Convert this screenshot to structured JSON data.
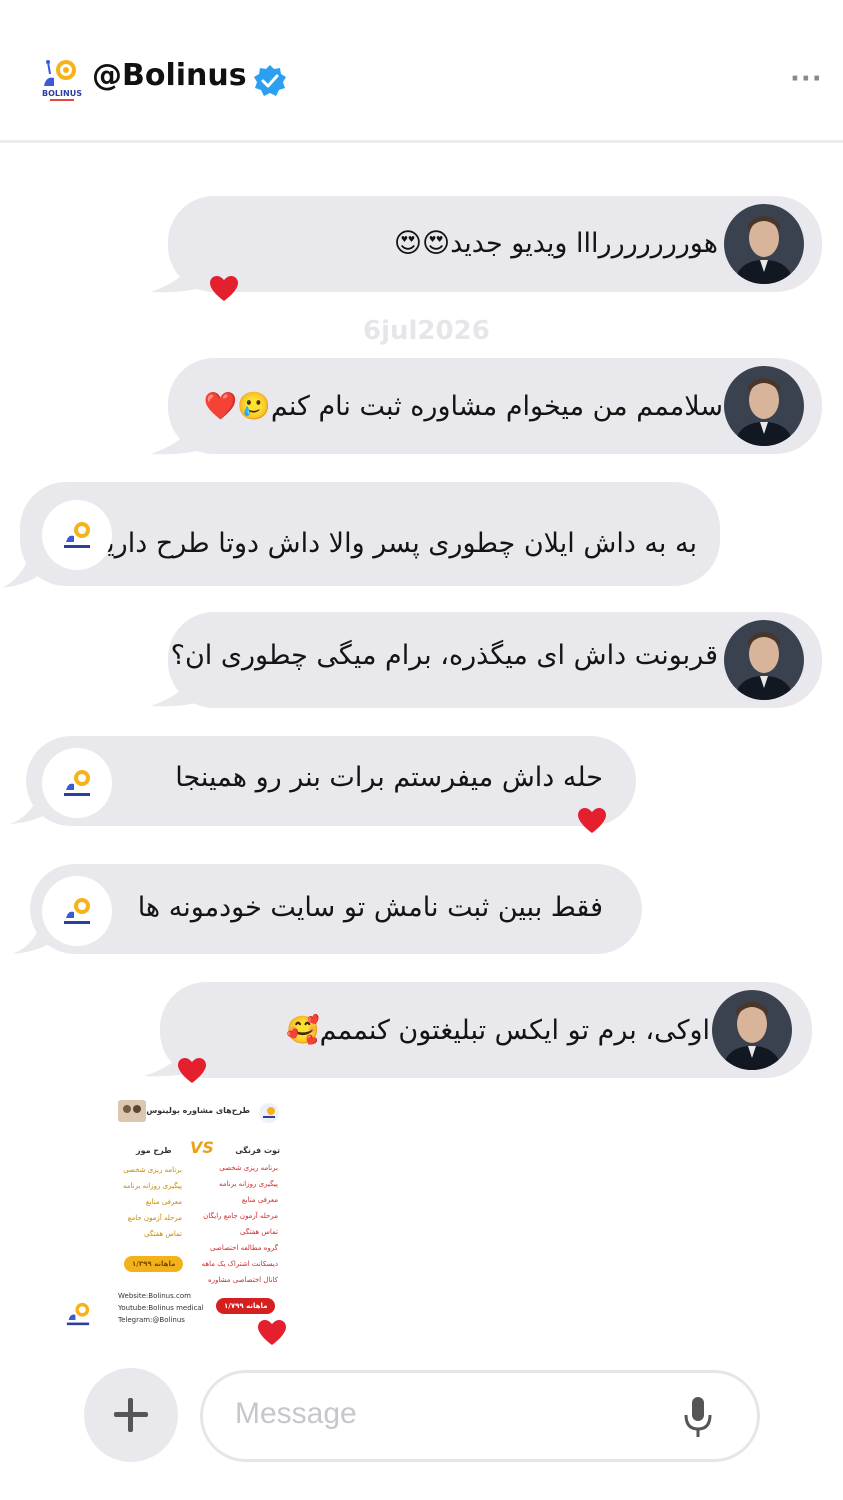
{
  "header": {
    "handle": "@Bolinus",
    "logo_text": "BOLINUS",
    "verified_color": "#2ca0f0",
    "more_label": "···"
  },
  "watermark": "6jul2026",
  "messages": [
    {
      "side": "right",
      "text": "هورررررررااا ویدیو جدید😍😍",
      "hearted": true
    },
    {
      "side": "right",
      "text": "سلاممم من میخوام مشاوره ثبت نام کنم🥲❤️",
      "hearted": false
    },
    {
      "side": "left",
      "text": "به به داش ایلان چطوری پسر والا داش دوتا طرح داریم",
      "hearted": false
    },
    {
      "side": "right",
      "text": "قربونت داش ای میگذره، برام میگی چطوری ان؟",
      "hearted": false
    },
    {
      "side": "left",
      "text": "حله داش میفرستم برات بنر رو همینجا",
      "hearted": true
    },
    {
      "side": "left",
      "text": "فقط ببین ثبت نامش تو سایت خودمونه ها",
      "hearted": false
    },
    {
      "side": "right",
      "text": "اوکی، برم تو ایکس تبلیغتون کنممم🥰",
      "hearted": true
    }
  ],
  "poster": {
    "title": "طرح‌های مشاوره بولینوس",
    "vs": "VS",
    "plan_banana": {
      "name": "طرح موز",
      "features": [
        "برنامه ریزی شخصی",
        "پیگیری روزانه برنامه",
        "معرفی منابع",
        "مرحله آزمون جامع",
        "تماس هفتگی"
      ],
      "price": "ماهانه ۱/۳۹۹"
    },
    "plan_strawberry": {
      "name": "توت فرنگی",
      "features": [
        "برنامه ریزی شخصی",
        "پیگیری روزانه برنامه",
        "معرفی منابع",
        "مرحله آزمون جامع رایگان",
        "تماس هفتگی",
        "گروه مطالعه اختصاصی",
        "دیسکانت اشتراک یک ماهه",
        "کانال اختصاصی مشاوره"
      ],
      "price": "ماهانه ۱/۷۹۹"
    },
    "links": [
      "Website:Bolinus.com",
      "Youtube:Bolinus medical",
      "Telegram:@Bolinus"
    ]
  },
  "composer": {
    "placeholder": "Message",
    "plus_label": "+"
  }
}
